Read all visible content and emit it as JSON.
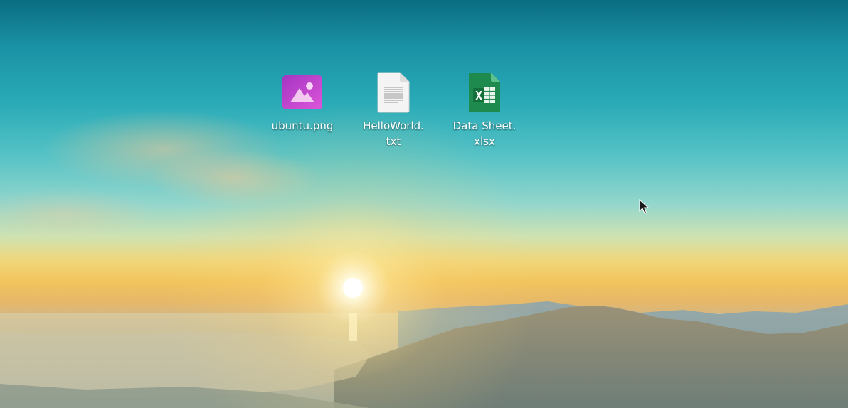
{
  "desktop": {
    "icons": [
      {
        "label": "ubuntu.png",
        "icon": "image-file-icon",
        "color": "#c23fcb"
      },
      {
        "label_line1": "HelloWorld.",
        "label_line2": "txt",
        "icon": "text-file-icon",
        "color": "#f3f3f3"
      },
      {
        "label_line1": "Data Sheet.",
        "label_line2": "xlsx",
        "icon": "spreadsheet-file-icon",
        "color": "#1d8a4f"
      }
    ]
  }
}
